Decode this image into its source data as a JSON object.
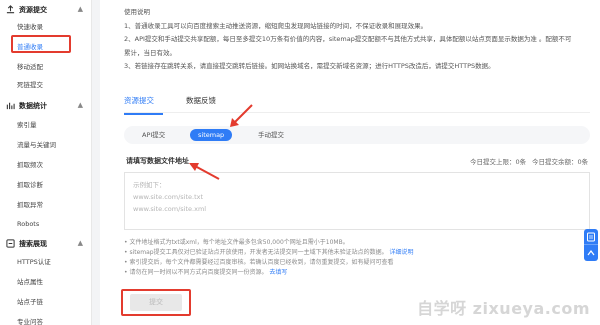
{
  "sidebar": {
    "sections": [
      {
        "title": "资源提交",
        "items": [
          "快速收录",
          "普通收录",
          "移动适配",
          "死链提交"
        ],
        "active": "普通收录"
      },
      {
        "title": "数据统计",
        "items": [
          "索引量",
          "流量与关键词",
          "抓取频次",
          "抓取诊断",
          "抓取异常",
          "Robots"
        ]
      },
      {
        "title": "搜索展现",
        "items": [
          "HTTPS认证",
          "站点属性",
          "站点子链",
          "专业问答"
        ]
      }
    ]
  },
  "instructions": {
    "heading": "使用说明",
    "lines": [
      "1、普通收录工具可以向百度搜索主动推送资源，缩短爬虫发现网站链接的时间，不保证收录和展现效果。",
      "2、API提交和手动提交共享配额，每日至多提交10万条有价值的内容，sitemap提交配额不与其他方式共享，具体配额以站点页面显示数据为准 。配额不可",
      "累计，当日有效。",
      "3、若链接存在跳转关系，请直接提交跳转后链接。如网站换域名，需提交新域名资源；进行HTTPS改造后，请提交HTTPS数据。"
    ]
  },
  "tabs": [
    "资源提交",
    "数据反馈"
  ],
  "subtabs": [
    "API提交",
    "sitemap",
    "手动提交"
  ],
  "field": {
    "title": "请填写数据文件地址",
    "quota_submitted": "今日提交上限：0条",
    "quota_remaining": "今日提交余额：0条",
    "placeholder_lines": [
      "示例如下：",
      "www.site.com/site.txt",
      "www.site.com/site.xml"
    ]
  },
  "notes": [
    "• 文件地址格式为txt或xml，每个地址文件最多包含50,000个网址且需小于10MB。",
    "• sitemap提交工具仅对已验证站点开放使用，开发者无法提交同一主域下其他未验证站点的数据。",
    "• 索引提交后，每个文件都需要经过百度审核。若确认百度已经收到，请勿重复提交，如有疑问可查看",
    "• 请勿在同一时间以不同方式向百度提交同一份资源。"
  ],
  "notes_link": "详细说明",
  "notes_link2": "去填写",
  "submit_label": "提交",
  "watermark": "自学呀 zixueya.com"
}
